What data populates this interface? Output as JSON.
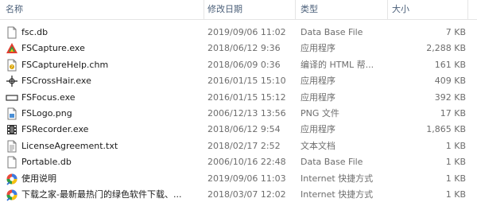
{
  "columns": {
    "name": "名称",
    "modified": "修改日期",
    "type": "类型",
    "size": "大小"
  },
  "sort_indicator": "^",
  "files": [
    {
      "icon": "database-file-icon",
      "name": "fsc.db",
      "date": "2019/09/06 11:02",
      "type": "Data Base File",
      "size": "7 KB"
    },
    {
      "icon": "fscapture-app-icon",
      "name": "FSCapture.exe",
      "date": "2018/06/12 9:36",
      "type": "应用程序",
      "size": "2,288 KB"
    },
    {
      "icon": "help-file-icon",
      "name": "FSCaptureHelp.chm",
      "date": "2018/06/09 0:36",
      "type": "编译的 HTML 帮...",
      "size": "161 KB"
    },
    {
      "icon": "crosshair-app-icon",
      "name": "FSCrossHair.exe",
      "date": "2016/01/15 15:10",
      "type": "应用程序",
      "size": "409 KB"
    },
    {
      "icon": "focus-app-icon",
      "name": "FSFocus.exe",
      "date": "2016/01/15 15:12",
      "type": "应用程序",
      "size": "392 KB"
    },
    {
      "icon": "png-image-icon",
      "name": "FSLogo.png",
      "date": "2006/12/13 13:56",
      "type": "PNG 文件",
      "size": "17 KB"
    },
    {
      "icon": "recorder-app-icon",
      "name": "FSRecorder.exe",
      "date": "2018/06/12 9:54",
      "type": "应用程序",
      "size": "1,865 KB"
    },
    {
      "icon": "text-document-icon",
      "name": "LicenseAgreement.txt",
      "date": "2018/02/17 2:52",
      "type": "文本文档",
      "size": "1 KB"
    },
    {
      "icon": "database-file-icon",
      "name": "Portable.db",
      "date": "2006/10/16 22:48",
      "type": "Data Base File",
      "size": "1 KB"
    },
    {
      "icon": "internet-shortcut-icon",
      "name": "使用说明",
      "date": "2019/09/06 11:03",
      "type": "Internet 快捷方式",
      "size": "1 KB"
    },
    {
      "icon": "internet-shortcut-icon",
      "name": "下载之家-最新最热门的绿色软件下载、...",
      "date": "2018/03/07 12:02",
      "type": "Internet 快捷方式",
      "size": "1 KB"
    }
  ]
}
